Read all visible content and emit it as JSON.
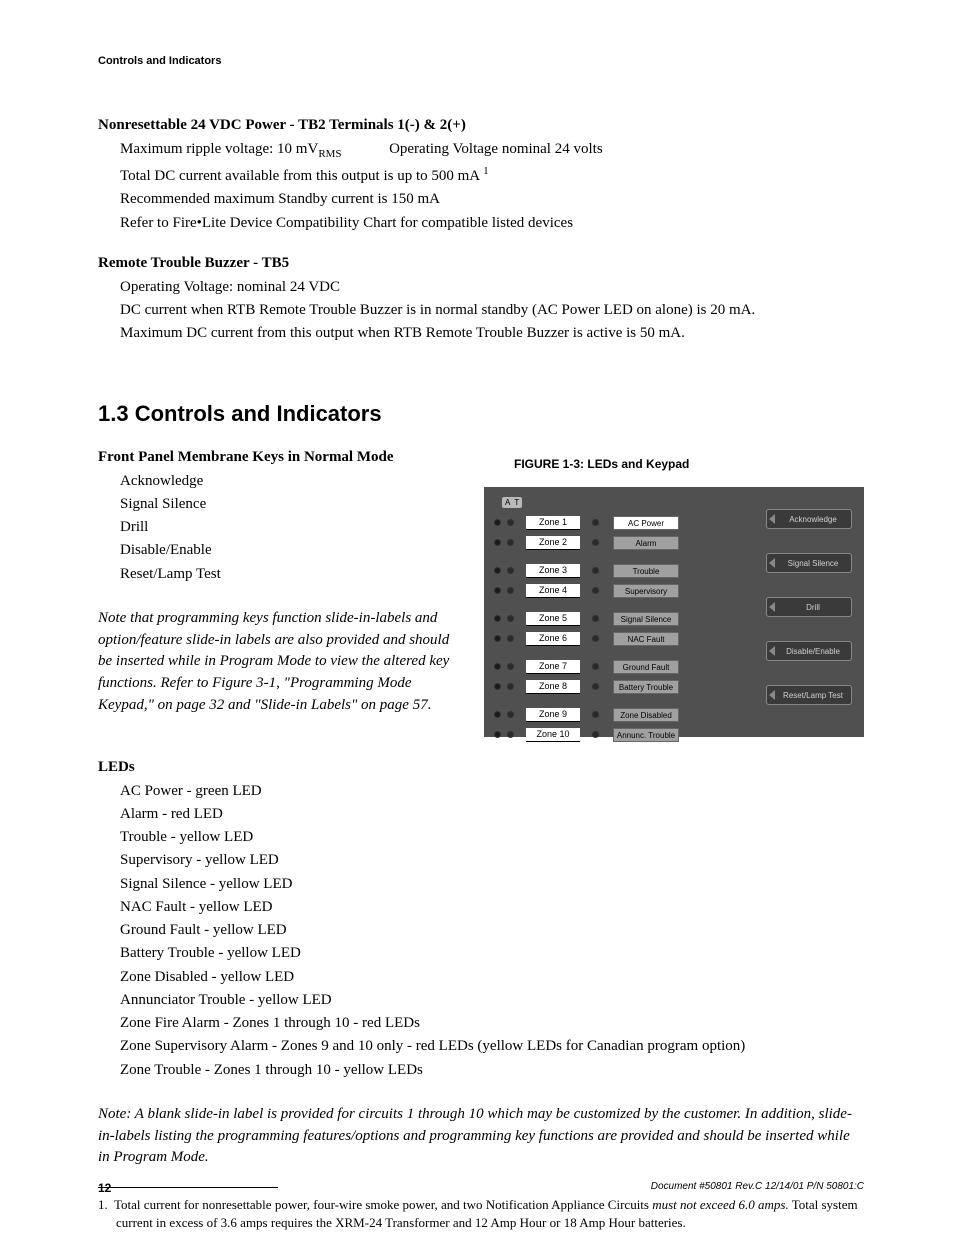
{
  "header": "Controls and Indicators",
  "sec1": {
    "title": "Nonresettable 24 VDC Power - TB2 Terminals 1(-) & 2(+)",
    "l1a": "Maximum ripple voltage: 10 mV",
    "l1b": "Operating Voltage nominal 24 volts",
    "l2a": "Total DC current available from this output is up to 500 mA ",
    "l3": "Recommended maximum Standby current is 150 mA",
    "l4": "Refer to Fire•Lite Device Compatibility Chart for compatible listed devices"
  },
  "sec2": {
    "title": "Remote Trouble Buzzer - TB5",
    "l1": "Operating Voltage: nominal 24 VDC",
    "l2": "DC current when RTB Remote Trouble Buzzer is in normal standby (AC Power LED on alone) is 20 mA.",
    "l3": "Maximum DC current from this output when RTB Remote Trouble Buzzer is active is 50 mA."
  },
  "sec3": {
    "title": "1.3    Controls and Indicators",
    "h1": "Front Panel Membrane Keys in Normal Mode",
    "keys": [
      "Acknowledge",
      "Signal Silence",
      "Drill",
      "Disable/Enable",
      "Reset/Lamp Test"
    ],
    "note": "Note that programming keys function slide-in-labels and option/feature slide-in labels are also provided and should be inserted while in Program Mode to view the altered key functions.  Refer to Figure 3-1, \"Programming Mode Keypad,\" on page 32 and \"Slide-in Labels\" on page 57.",
    "ledshead": "LEDs",
    "leds": [
      "AC Power - green LED",
      "Alarm - red LED",
      "Trouble - yellow LED",
      "Supervisory - yellow LED",
      "Signal Silence - yellow LED",
      "NAC Fault - yellow LED",
      "Ground Fault - yellow LED",
      "Battery Trouble - yellow LED",
      "Zone Disabled - yellow LED",
      "Annunciator Trouble - yellow LED",
      "Zone Fire Alarm - Zones 1 through 10 - red LEDs",
      "Zone Supervisory Alarm - Zones 9 and 10 only - red LEDs (yellow LEDs for Canadian program option)",
      "Zone Trouble - Zones 1 through 10 - yellow LEDs"
    ],
    "note2": "Note: A blank slide-in label is provided for circuits 1 through 10 which may be customized by the customer.  In addition, slide-in-labels listing the programming features/options and programming key functions are provided and should be inserted while in Program Mode."
  },
  "figure": {
    "caption_pre": "FIGURE 1-3:",
    "caption": "LEDs and Keypad",
    "at": [
      "A",
      "T"
    ],
    "zones": [
      "Zone 1",
      "Zone 2",
      "Zone 3",
      "Zone 4",
      "Zone 5",
      "Zone 6",
      "Zone 7",
      "Zone 8",
      "Zone 9",
      "Zone 10"
    ],
    "status": [
      "AC Power",
      "Alarm",
      "Trouble",
      "Supervisory",
      "Signal Silence",
      "NAC Fault",
      "Ground Fault",
      "Battery Trouble",
      "Zone Disabled",
      "Annunc. Trouble"
    ],
    "buttons": [
      "Acknowledge",
      "Signal Silence",
      "Drill",
      "Disable/Enable",
      "Reset/Lamp Test"
    ]
  },
  "footnote": {
    "num": "1.",
    "text_a": "Total current for nonresettable power, four-wire smoke power, and two Notification Appliance Circuits ",
    "text_em": "must not exceed 6.0 amps.",
    "text_b": "  Total system current in excess of 3.6 amps requires the XRM-24 Transformer and 12 Amp Hour or 18 Amp Hour batteries."
  },
  "footer": {
    "page": "12",
    "doc": "Document #50801    Rev.C   12/14/01    P/N 50801:C"
  }
}
